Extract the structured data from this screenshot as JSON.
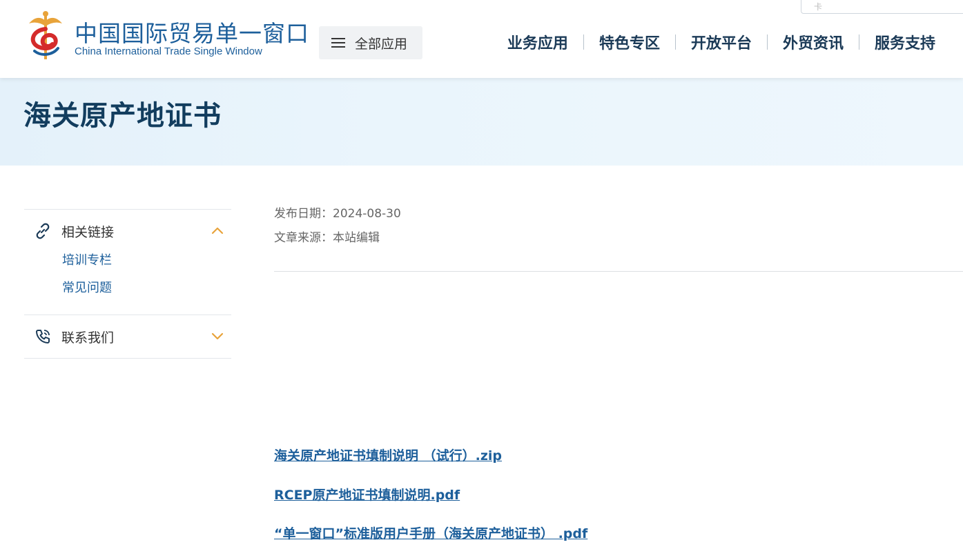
{
  "header": {
    "logo_cn": "中国国际贸易单一窗口",
    "logo_en": "China International Trade Single Window",
    "all_apps_label": "全部应用",
    "nav": [
      "业务应用",
      "特色专区",
      "开放平台",
      "外贸资讯",
      "服务支持"
    ],
    "search_placeholder": "卡"
  },
  "banner": {
    "title": "海关原产地证书"
  },
  "sidebar": {
    "groups": [
      {
        "title": "相关链接",
        "icon": "link-icon",
        "expanded": true,
        "items": [
          "培训专栏",
          "常见问题"
        ]
      },
      {
        "title": "联系我们",
        "icon": "phone-icon",
        "expanded": false,
        "items": []
      }
    ]
  },
  "article": {
    "publish_date": "发布日期：2024-08-30",
    "source": "文章来源：本站编辑",
    "attachments": [
      "海关原产地证书填制说明 （试行）.zip",
      "RCEP原产地证书填制说明.pdf",
      "“单一窗口”标准版用户手册（海关原产地证书） .pdf"
    ]
  },
  "colors": {
    "brand_blue": "#1d5f9b",
    "title_dark": "#123d5e",
    "accent_gold": "#e8a33a",
    "banner_bg": "#e4f1fa"
  }
}
